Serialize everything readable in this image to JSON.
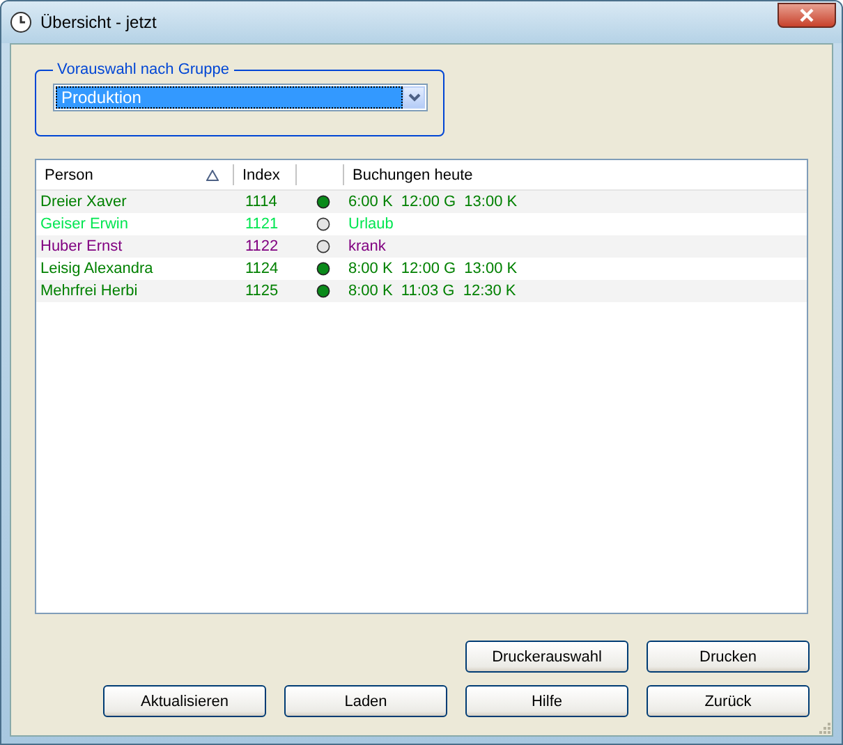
{
  "window": {
    "title": "Übersicht - jetzt"
  },
  "group": {
    "label": "Vorauswahl nach Gruppe",
    "value": "Produktion"
  },
  "table": {
    "columns": [
      {
        "label": "Person",
        "sorted": true
      },
      {
        "label": "Index",
        "sorted": false
      },
      {
        "sorted": false
      },
      {
        "label": "Buchungen heute",
        "sorted": false
      }
    ],
    "rows": [
      {
        "person": "Dreier Xaver",
        "index": "1114",
        "present": true,
        "bookings": "6:00 K  12:00 G  13:00 K",
        "color": "#008000"
      },
      {
        "person": "Geiser Erwin",
        "index": "1121",
        "present": false,
        "bookings": "Urlaub",
        "color": "#00e650"
      },
      {
        "person": "Huber Ernst",
        "index": "1122",
        "present": false,
        "bookings": "krank",
        "color": "#800080"
      },
      {
        "person": "Leisig Alexandra",
        "index": "1124",
        "present": true,
        "bookings": "8:00 K  12:00 G  13:00 K",
        "color": "#008000"
      },
      {
        "person": "Mehrfrei Herbi",
        "index": "1125",
        "present": true,
        "bookings": "8:00 K  11:03 G  12:30 K",
        "color": "#008000"
      }
    ]
  },
  "button_rows": [
    [
      "Druckerauswahl",
      "Drucken"
    ],
    [
      "Aktualisieren",
      "Laden",
      "Hilfe",
      "Zurück"
    ]
  ]
}
